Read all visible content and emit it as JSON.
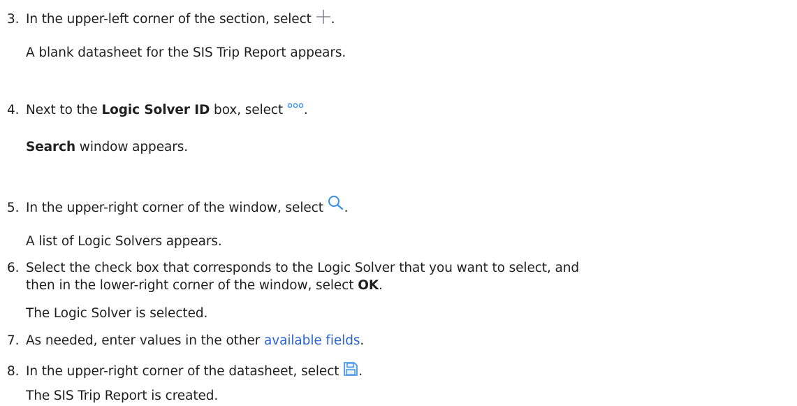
{
  "steps": [
    {
      "number": "3.",
      "text_before": "In the upper-left corner of the section, select",
      "icon": "plus-icon",
      "text_after": ".",
      "result": "A blank datasheet for the SIS Trip Report appears."
    },
    {
      "number": "4.",
      "text_before": "Next to the",
      "bold": "Logic Solver ID",
      "text_middle": "box, select",
      "icon": "ellipsis-icon",
      "text_after": ".",
      "result_bold": "Search",
      "result_rest": "window appears."
    },
    {
      "number": "5.",
      "text_before": "In the upper-right corner of the window, select",
      "icon": "search-icon",
      "text_after": ".",
      "result": "A list of Logic Solvers appears."
    },
    {
      "number": "6.",
      "line1": "Select the check box that corresponds to the Logic Solver that you want to select, and",
      "line2_before": "then in the lower-right corner of the window, select",
      "line2_bold": "OK",
      "line2_after": ".",
      "result": "The Logic Solver is selected."
    },
    {
      "number": "7.",
      "text_before": "As needed, enter values in the other",
      "link": "available fields",
      "text_after": "."
    },
    {
      "number": "8.",
      "text_before": "In the upper-right corner of the datasheet, select",
      "icon": "save-icon",
      "text_after": ".",
      "result": "The SIS Trip Report is created."
    }
  ],
  "colors": {
    "text": "#1f1f1f",
    "link": "#2a63d4",
    "icon_blue": "#3a8ee6",
    "plus_icon": "#6b6b8a"
  }
}
